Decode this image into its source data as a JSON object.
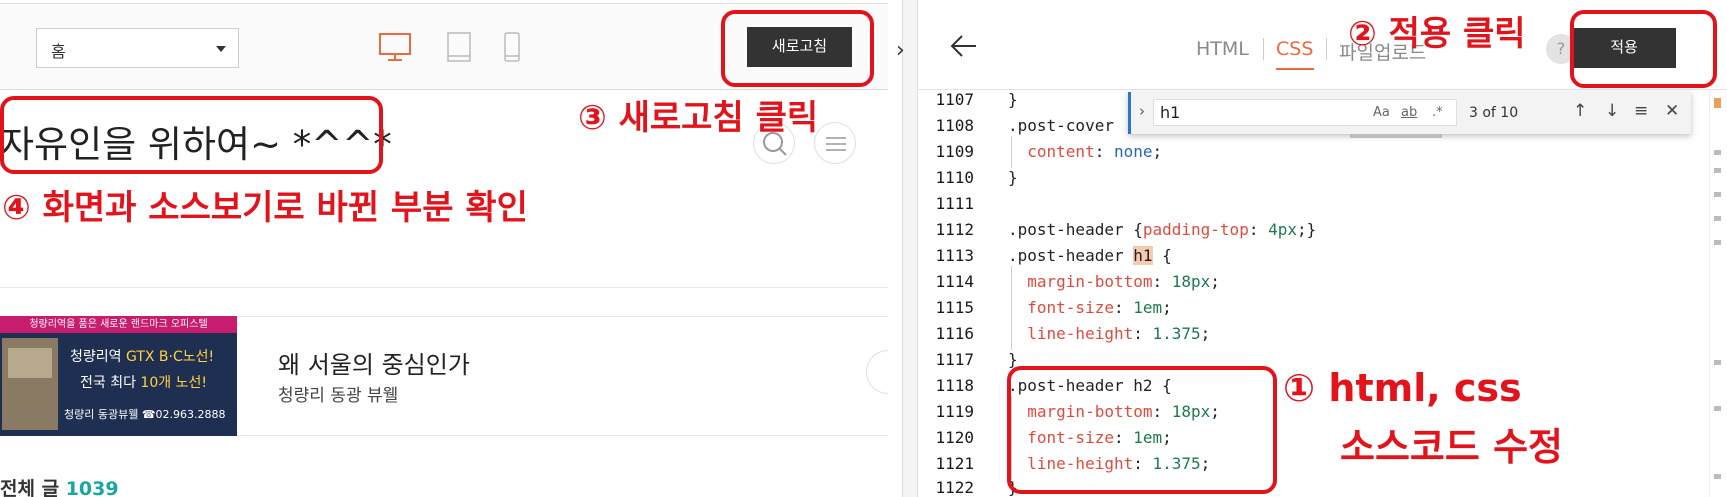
{
  "left": {
    "select_value": "홈",
    "refresh_label": "새로고침",
    "blog_title": "자유인을 위하여~ *^^*",
    "ad": {
      "top_banner": "청량리역을 품은 새로운 랜드마크 오피스텔",
      "line1_a": "청량리역 ",
      "line1_b": "GTX B·C노선!",
      "line2_a": "전국 최다 ",
      "line2_b": "10개 노선!",
      "line3": "청량리 동광뷰웰 ☎02.963.2888",
      "headline": "왜 서울의 중심인가",
      "sub": "청량리 동광 뷰웰"
    },
    "total_label": "전체 글",
    "total_count": "1039"
  },
  "right": {
    "tabs": [
      "HTML",
      "CSS",
      "파일업로드"
    ],
    "apply_label": "적용",
    "help": "?",
    "find": {
      "query": "h1",
      "opt_case": "Aa",
      "opt_word": "ab",
      "opt_regex": ".*",
      "count": "3 of 10",
      "prev": "↑",
      "next": "↓",
      "select": "≡",
      "close": "✕"
    },
    "code_lines": [
      {
        "n": "1107",
        "t": "}"
      },
      {
        "n": "1108",
        "t": ".post-cover"
      },
      {
        "n": "1109",
        "t": "  content: none;"
      },
      {
        "n": "1110",
        "t": "}"
      },
      {
        "n": "1111",
        "t": ""
      },
      {
        "n": "1112",
        "t": ".post-header {padding-top: 4px;}"
      },
      {
        "n": "1113",
        "t": ".post-header h1 {"
      },
      {
        "n": "1114",
        "t": "  margin-bottom: 18px;"
      },
      {
        "n": "1115",
        "t": "  font-size: 1em;"
      },
      {
        "n": "1116",
        "t": "  line-height: 1.375;"
      },
      {
        "n": "1117",
        "t": "}"
      },
      {
        "n": "1118",
        "t": ".post-header h2 {"
      },
      {
        "n": "1119",
        "t": "  margin-bottom: 18px;"
      },
      {
        "n": "1120",
        "t": "  font-size: 1em;"
      },
      {
        "n": "1121",
        "t": "  line-height: 1.375;"
      },
      {
        "n": "1122",
        "t": "}"
      }
    ]
  },
  "annotations": {
    "step1_line1": "① html, css",
    "step1_line2": "소스코드 수정",
    "step2": "② 적용 클릭",
    "step3": "③ 새로고침 클릭",
    "step4": "④ 화면과 소스보기로 바뀐 부분 확인",
    "color": "#e3131b"
  },
  "colors": {
    "accent_tab": "#ee6a3e",
    "css_property": "#e34a3f",
    "css_value": "#1b7b4b",
    "css_keyword": "#2b64b9",
    "button_dark": "#333333",
    "count_teal": "#1aa6a0"
  }
}
